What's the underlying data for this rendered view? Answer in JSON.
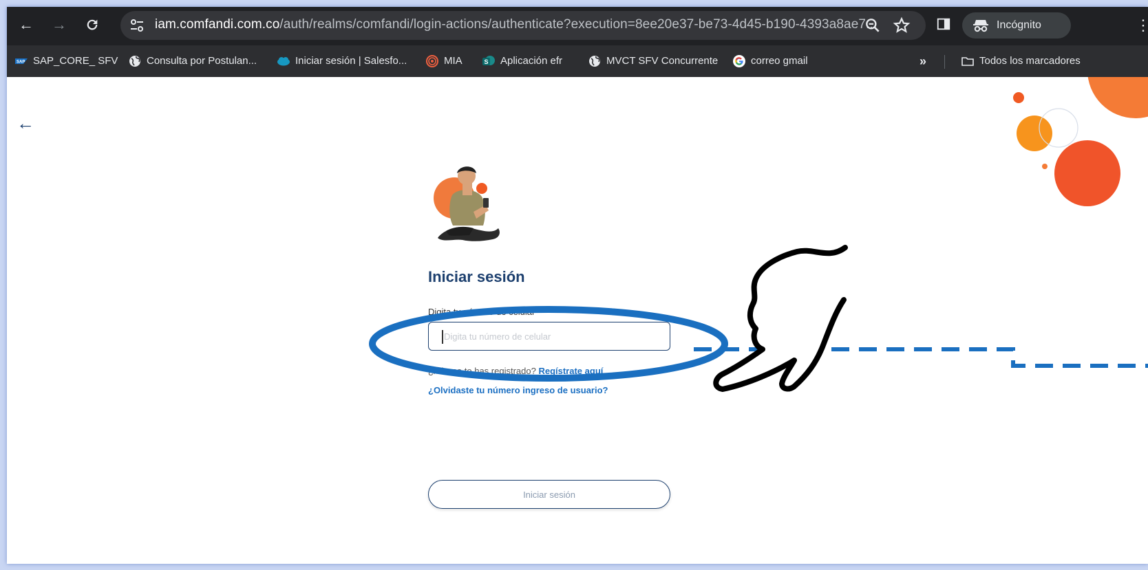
{
  "browser": {
    "url_host": "iam.comfandi.com.co",
    "url_rest": "/auth/realms/comfandi/login-actions/authenticate?execution=8ee20e37-be73-4d45-b190-4393a8ae7...",
    "incognito_label": "Incógnito"
  },
  "bookmarks": {
    "items": [
      {
        "label": "SAP_CORE_ SFV",
        "icon": "sap-icon"
      },
      {
        "label": "Consulta por Postulan...",
        "icon": "globe-icon"
      },
      {
        "label": "Iniciar sesión | Salesfo...",
        "icon": "salesforce-cloud-icon"
      },
      {
        "label": "MIA",
        "icon": "mia-icon"
      },
      {
        "label": "Aplicación efr",
        "icon": "sharepoint-icon"
      },
      {
        "label": "MVCT SFV Concurrente",
        "icon": "globe-icon"
      },
      {
        "label": "correo gmail",
        "icon": "google-icon"
      }
    ],
    "overflow": "»",
    "all_bookmarks": "Todos los marcadores"
  },
  "login": {
    "title": "Iniciar sesión",
    "phone_label": "Digita tu número de celular",
    "phone_placeholder": "Digita tu número de celular",
    "phone_value": "",
    "register_prefix": "¿Aún no te has registrado?",
    "register_link": "Regístrate aquí",
    "forgot_link": "¿Olvidaste tu número ingreso de usuario?",
    "submit_label": "Iniciar sesión"
  },
  "colors": {
    "brand_navy": "#1c3f6e",
    "link_blue": "#1b6fc2",
    "annotation_blue": "#1a6fc0",
    "brand_orange": "#f47b36"
  }
}
